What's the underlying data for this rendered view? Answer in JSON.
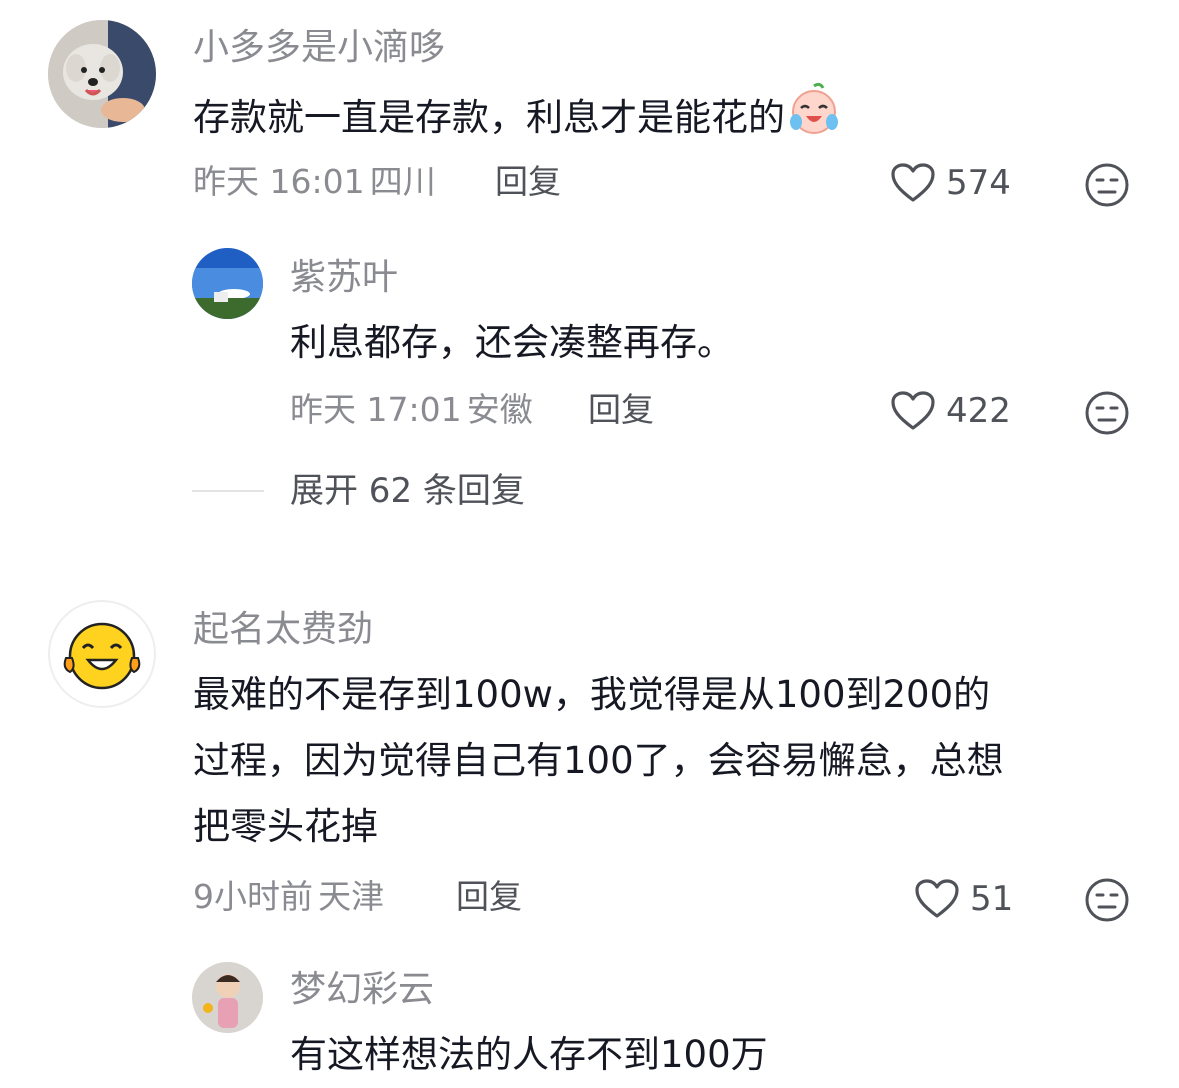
{
  "comments": [
    {
      "username": "小多多是小滴哆",
      "text": "存款就一直是存款，利息才是能花的",
      "time": "昨天 16:01",
      "location": "四川",
      "reply_label": "回复",
      "likes": "574",
      "reply": {
        "username": "紫苏叶",
        "text": "利息都存，还会凑整再存。",
        "time": "昨天 17:01",
        "location": "安徽",
        "reply_label": "回复",
        "likes": "422"
      },
      "expand_label": "展开 62 条回复"
    },
    {
      "username": "起名太费劲",
      "text_lines": [
        "最难的不是存到100w，我觉得是从100到200的",
        "过程，因为觉得自己有100了，会容易懈怠，总想",
        "把零头花掉"
      ],
      "time": "9小时前",
      "location": "天津",
      "reply_label": "回复",
      "likes": "51",
      "reply": {
        "username": "梦幻彩云",
        "text": "有这样想法的人存不到100万"
      }
    }
  ],
  "icons": {
    "like": "heart-outline-icon",
    "dislike": "neutral-face-icon",
    "emoji": "crying-laughing-emoji"
  },
  "colors": {
    "username": "#8a8b91",
    "text": "#161823",
    "meta": "#8a8b91",
    "action": "#505259"
  }
}
